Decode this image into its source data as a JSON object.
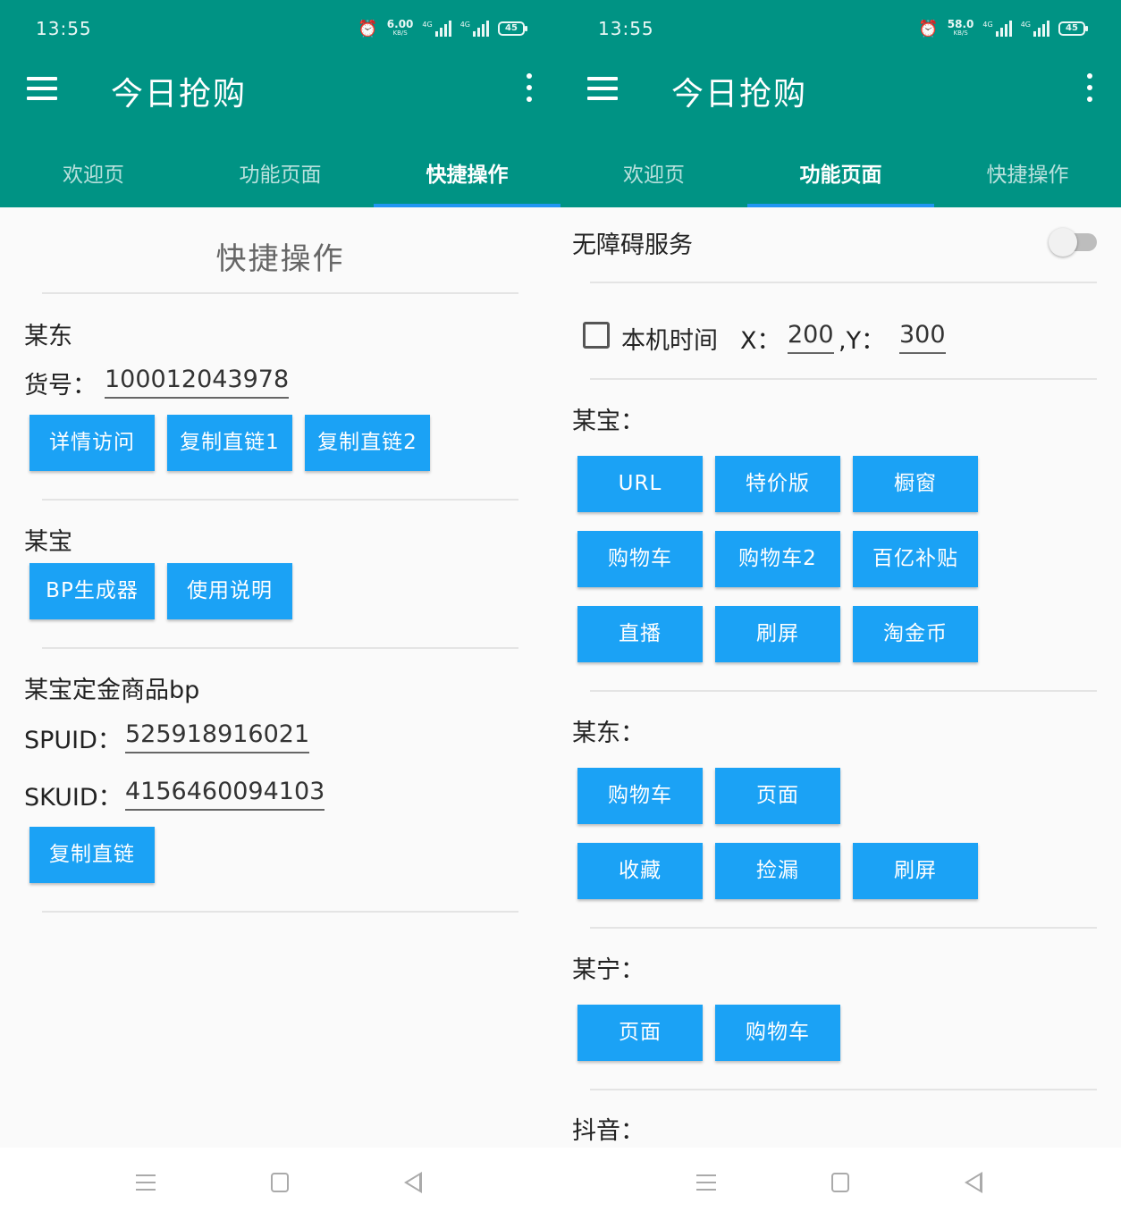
{
  "status_bar": {
    "time": "13:55",
    "left_speed": "6.00",
    "right_speed": "58.0",
    "speed_unit": "KB/S",
    "net_type": "4G",
    "battery": "45"
  },
  "app_title": "今日抢购",
  "tabs": [
    "欢迎页",
    "功能页面",
    "快捷操作"
  ],
  "quick_ops": {
    "heading": "快捷操作",
    "jd": {
      "title": "某东",
      "item_label": "货号：",
      "item_value": "100012043978",
      "buttons": [
        "详情访问",
        "复制直链1",
        "复制直链2"
      ]
    },
    "taobao": {
      "title": "某宝",
      "buttons": [
        "BP生成器",
        "使用说明"
      ]
    },
    "deposit": {
      "title": "某宝定金商品bp",
      "spuid_label": "SPUID：",
      "spuid_value": "525918916021",
      "skuid_label": "SKUID：",
      "skuid_value": "4156460094103",
      "button": "复制直链"
    }
  },
  "functions": {
    "accessibility_label": "无障碍服务",
    "accessibility_on": false,
    "local_time_label": "本机时间",
    "x_label": "X：",
    "x_value": "200",
    "y_label": ",Y：",
    "y_value": "300",
    "taobao": {
      "title": "某宝：",
      "buttons": [
        "URL",
        "特价版",
        "橱窗",
        "购物车",
        "购物车2",
        "百亿补贴",
        "直播",
        "刷屏",
        "淘金币"
      ]
    },
    "jd": {
      "title": "某东：",
      "buttons": [
        "购物车",
        "页面",
        "收藏",
        "捡漏",
        "刷屏"
      ]
    },
    "suning": {
      "title": "某宁：",
      "buttons": [
        "页面",
        "购物车"
      ]
    },
    "douyin": {
      "title": "抖音："
    }
  },
  "colors": {
    "appbar": "#009384",
    "button": "#1ba2f5",
    "tab_indicator": "#2196f3"
  }
}
